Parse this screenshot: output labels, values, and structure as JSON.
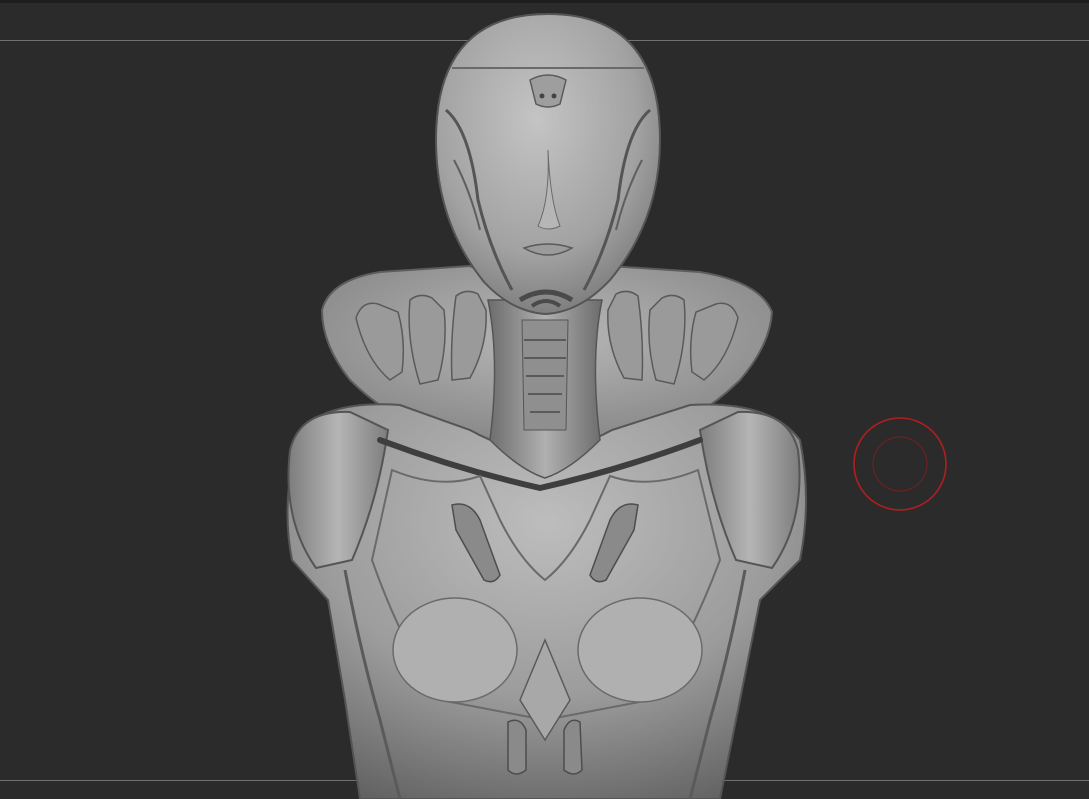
{
  "viewport": {
    "background_color": "#2b2b2b",
    "guide_line_color": "#8a8a8a"
  },
  "model": {
    "surface_color": "#a3a3a3",
    "shadow_color": "#5a5a5a",
    "highlight_color": "#cfcfcf"
  },
  "brush_cursor": {
    "icon": "brush-cursor-icon",
    "ring_color": "#b01e1e"
  }
}
